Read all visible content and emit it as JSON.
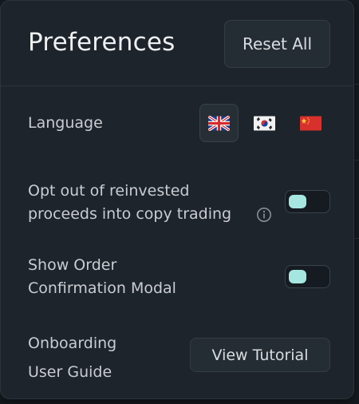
{
  "panel": {
    "title": "Preferences",
    "reset_label": "Reset All"
  },
  "language": {
    "label": "Language",
    "options": [
      {
        "name": "english-flag-icon",
        "selected": true
      },
      {
        "name": "korean-flag-icon",
        "selected": false
      },
      {
        "name": "chinese-flag-icon",
        "selected": false
      }
    ]
  },
  "opt_out": {
    "label_line1": "Opt out of reinvested",
    "label_line2": "proceeds into copy trading",
    "icon": "info-icon",
    "toggle_on": false
  },
  "order_confirmation": {
    "label_line1": "Show Order",
    "label_line2": "Confirmation Modal",
    "toggle_on": false
  },
  "onboarding": {
    "label_line1": "Onboarding",
    "label_line2": "User Guide",
    "button_label": "View Tutorial"
  },
  "colors": {
    "panel_bg": "#1d242b",
    "accent_toggle": "#a6e6e0",
    "text_primary": "#eef1f3"
  }
}
